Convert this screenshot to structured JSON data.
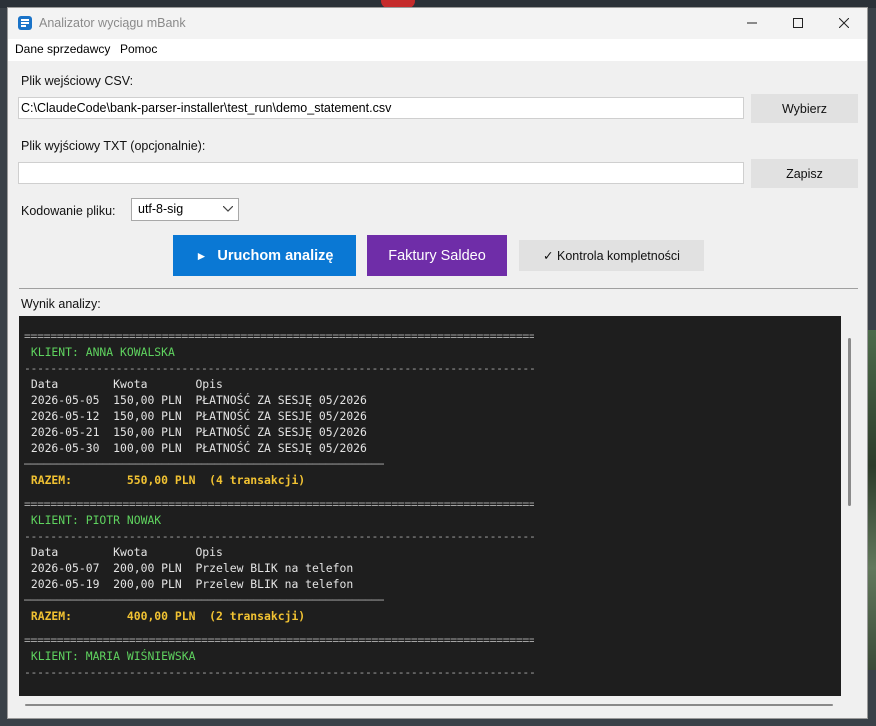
{
  "window": {
    "title": "Analizator wyciągu mBank"
  },
  "menu": {
    "items": [
      "Dane sprzedawcy",
      "Pomoc"
    ]
  },
  "input_csv": {
    "label": "Plik wejściowy CSV:",
    "value": "C:\\ClaudeCode\\bank-parser-installer\\test_run\\demo_statement.csv",
    "button": "Wybierz"
  },
  "output_txt": {
    "label": "Plik wyjściowy TXT (opcjonalnie):",
    "value": "",
    "button": "Zapisz"
  },
  "encoding": {
    "label": "Kodowanie pliku:",
    "selected": "utf-8-sig"
  },
  "actions": {
    "run_icon": "►",
    "run_label": "Uruchom analizę",
    "saldeo_label": "Faktury Saldeo",
    "check_label": "✓ Kontrola kompletności"
  },
  "result": {
    "label": "Wynik analizy:",
    "lines": [
      {
        "type": "rule",
        "text": "========================================================================================"
      },
      {
        "type": "client",
        "text": " KLIENT: ANNA KOWALSKA"
      },
      {
        "type": "rule",
        "text": "----------------------------------------------------------------------------------------"
      },
      {
        "type": "head",
        "text": " Data        Kwota       Opis"
      },
      {
        "type": "row",
        "text": " 2026-05-05  150,00 PLN  PŁATNOŚĆ ZA SESJĘ 05/2026"
      },
      {
        "type": "row",
        "text": " 2026-05-12  150,00 PLN  PŁATNOŚĆ ZA SESJĘ 05/2026"
      },
      {
        "type": "row",
        "text": " 2026-05-21  150,00 PLN  PŁATNOŚĆ ZA SESJĘ 05/2026"
      },
      {
        "type": "row",
        "text": " 2026-05-30  100,00 PLN  PŁATNOŚĆ ZA SESJĘ 05/2026"
      },
      {
        "type": "rule-short",
        "text": "────────────────────────────────────────────────────────"
      },
      {
        "type": "total",
        "text": " RAZEM:        550,00 PLN  (4 transakcji)"
      },
      {
        "type": "gap",
        "text": ""
      },
      {
        "type": "rule",
        "text": "========================================================================================"
      },
      {
        "type": "client",
        "text": " KLIENT: PIOTR NOWAK"
      },
      {
        "type": "rule",
        "text": "----------------------------------------------------------------------------------------"
      },
      {
        "type": "head",
        "text": " Data        Kwota       Opis"
      },
      {
        "type": "row",
        "text": " 2026-05-07  200,00 PLN  Przelew BLIK na telefon"
      },
      {
        "type": "row",
        "text": " 2026-05-19  200,00 PLN  Przelew BLIK na telefon"
      },
      {
        "type": "rule-short",
        "text": "────────────────────────────────────────────────────────"
      },
      {
        "type": "total",
        "text": " RAZEM:        400,00 PLN  (2 transakcji)"
      },
      {
        "type": "gap",
        "text": ""
      },
      {
        "type": "rule",
        "text": "========================================================================================"
      },
      {
        "type": "client",
        "text": " KLIENT: MARIA WIŚNIEWSKA"
      },
      {
        "type": "rule",
        "text": "----------------------------------------------------------------------------------------"
      }
    ]
  },
  "colors": {
    "run_button": "#0a78d4",
    "saldeo_button": "#6f2da8",
    "client_text": "#5fd35f",
    "total_text": "#f1c232",
    "output_bg": "#1e1e1e"
  }
}
